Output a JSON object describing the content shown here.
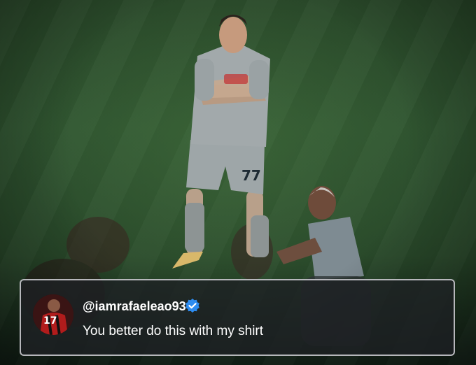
{
  "comment": {
    "username": "@iamrafaeleao93",
    "verified": true,
    "text": "You better do this with my shirt",
    "avatar_jersey_number": "17"
  },
  "colors": {
    "card_background": "#1e2024",
    "card_border": "#d2d2d7",
    "verified_badge": "#2d8cf0",
    "pitch_green": "#2f5530"
  },
  "icons": [
    "verified-icon"
  ]
}
